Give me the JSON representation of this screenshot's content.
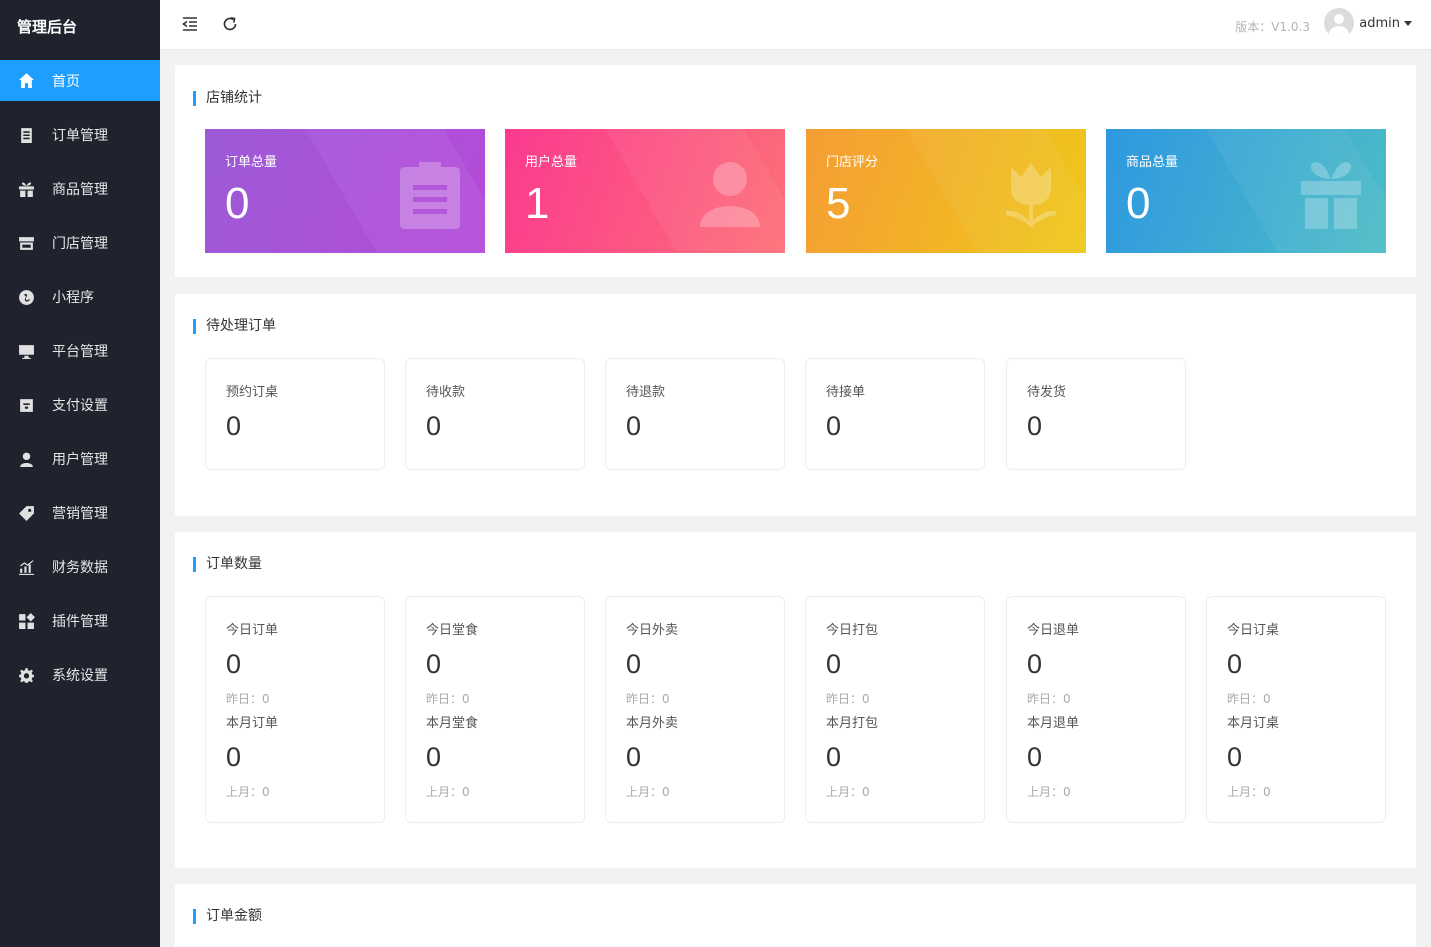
{
  "sidebar": {
    "brand": "管理后台",
    "items": [
      {
        "label": "首页",
        "icon": "home-icon"
      },
      {
        "label": "订单管理",
        "icon": "order-icon"
      },
      {
        "label": "商品管理",
        "icon": "gift-icon"
      },
      {
        "label": "门店管理",
        "icon": "store-icon"
      },
      {
        "label": "小程序",
        "icon": "mini-program-icon"
      },
      {
        "label": "平台管理",
        "icon": "monitor-icon"
      },
      {
        "label": "支付设置",
        "icon": "wallet-icon"
      },
      {
        "label": "用户管理",
        "icon": "user-icon"
      },
      {
        "label": "营销管理",
        "icon": "tag-icon"
      },
      {
        "label": "财务数据",
        "icon": "chart-icon"
      },
      {
        "label": "插件管理",
        "icon": "plugin-icon"
      },
      {
        "label": "系统设置",
        "icon": "gear-icon"
      }
    ]
  },
  "header": {
    "version": "版本：V1.0.3",
    "user": "admin"
  },
  "store_stats": {
    "title": "店铺统计",
    "cards": [
      {
        "label": "订单总量",
        "value": "0",
        "icon": "clipboard-icon",
        "colors": [
          "#9b59d6",
          "#b34fd8"
        ]
      },
      {
        "label": "用户总量",
        "value": "1",
        "icon": "user-icon",
        "colors": [
          "#fb3b8c",
          "#fd6f7a"
        ]
      },
      {
        "label": "门店评分",
        "value": "5",
        "icon": "tulip-icon",
        "colors": [
          "#f4a233",
          "#f0c418"
        ]
      },
      {
        "label": "商品总量",
        "value": "0",
        "icon": "gift-icon",
        "colors": [
          "#2f9bdf",
          "#4cb9c8"
        ]
      }
    ]
  },
  "pending_orders": {
    "title": "待处理订单",
    "items": [
      {
        "label": "预约订桌",
        "value": "0"
      },
      {
        "label": "待收款",
        "value": "0"
      },
      {
        "label": "待退款",
        "value": "0"
      },
      {
        "label": "待接单",
        "value": "0"
      },
      {
        "label": "待发货",
        "value": "0"
      }
    ]
  },
  "order_counts": {
    "title": "订单数量",
    "items": [
      {
        "label": "今日订单",
        "value": "0",
        "yesterday": "昨日：0",
        "month_label": "本月订单",
        "month_value": "0",
        "last_month": "上月：0"
      },
      {
        "label": "今日堂食",
        "value": "0",
        "yesterday": "昨日：0",
        "month_label": "本月堂食",
        "month_value": "0",
        "last_month": "上月：0"
      },
      {
        "label": "今日外卖",
        "value": "0",
        "yesterday": "昨日：0",
        "month_label": "本月外卖",
        "month_value": "0",
        "last_month": "上月：0"
      },
      {
        "label": "今日打包",
        "value": "0",
        "yesterday": "昨日：0",
        "month_label": "本月打包",
        "month_value": "0",
        "last_month": "上月：0"
      },
      {
        "label": "今日退单",
        "value": "0",
        "yesterday": "昨日：0",
        "month_label": "本月退单",
        "month_value": "0",
        "last_month": "上月：0"
      },
      {
        "label": "今日订桌",
        "value": "0",
        "yesterday": "昨日：0",
        "month_label": "本月订桌",
        "month_value": "0",
        "last_month": "上月：0"
      }
    ]
  },
  "order_amount": {
    "title": "订单金额"
  }
}
